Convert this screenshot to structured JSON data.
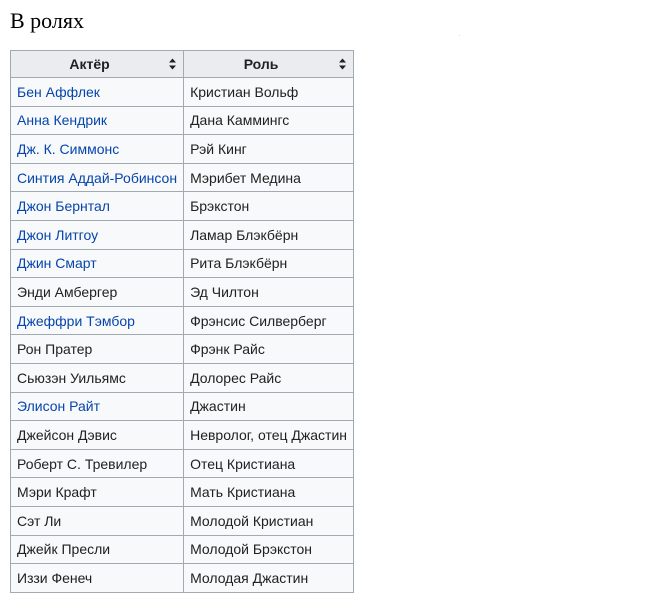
{
  "section": {
    "heading": "В ролях"
  },
  "table": {
    "headers": {
      "actor": "Актёр",
      "role": "Роль"
    },
    "rows": [
      {
        "actor": "Бен Аффлек",
        "role": "Кристиан Вольф",
        "linked": true
      },
      {
        "actor": "Анна Кендрик",
        "role": "Дана Каммингс",
        "linked": true
      },
      {
        "actor": "Дж. К. Симмонс",
        "role": "Рэй Кинг",
        "linked": true
      },
      {
        "actor": "Синтия Аддай-Робинсон",
        "role": "Мэрибет Медина",
        "linked": true
      },
      {
        "actor": "Джон Бернтал",
        "role": "Брэкстон",
        "linked": true
      },
      {
        "actor": "Джон Литгоу",
        "role": "Ламар Блэкбёрн",
        "linked": true
      },
      {
        "actor": "Джин Смарт",
        "role": "Рита Блэкбёрн",
        "linked": true
      },
      {
        "actor": "Энди Амбергер",
        "role": "Эд Чилтон",
        "linked": false
      },
      {
        "actor": "Джеффри Тэмбор",
        "role": "Фрэнсис Силверберг",
        "linked": true
      },
      {
        "actor": "Рон Пратер",
        "role": "Фрэнк Райс",
        "linked": false
      },
      {
        "actor": "Сьюзэн Уильямс",
        "role": "Долорес Райс",
        "linked": false
      },
      {
        "actor": "Элисон Райт",
        "role": "Джастин",
        "linked": true
      },
      {
        "actor": "Джейсон Дэвис",
        "role": "Невролог, отец Джастин",
        "linked": false
      },
      {
        "actor": "Роберт С. Тревилер",
        "role": "Отец Кристиана",
        "linked": false
      },
      {
        "actor": "Мэри Крафт",
        "role": "Мать Кристиана",
        "linked": false
      },
      {
        "actor": "Сэт Ли",
        "role": "Молодой Кристиан",
        "linked": false
      },
      {
        "actor": "Джейк Пресли",
        "role": "Молодой Брэкстон",
        "linked": false
      },
      {
        "actor": "Иззи Фенеч",
        "role": "Молодая Джастин",
        "linked": false
      }
    ]
  },
  "colors": {
    "link": "#0645ad",
    "text": "#202122",
    "header_bg": "#eaecf0",
    "cell_bg": "#f8f9fa",
    "border": "#a2a9b1"
  },
  "icons": {
    "sort": "sort-updown-icon"
  }
}
